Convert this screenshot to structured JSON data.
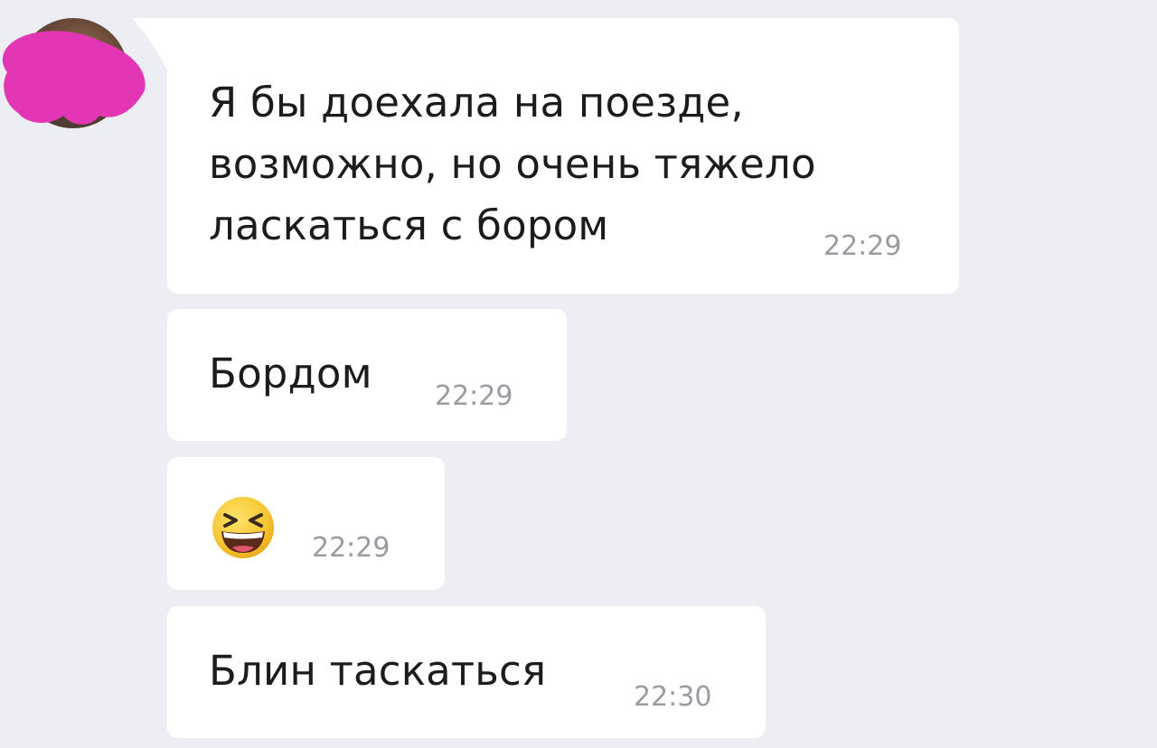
{
  "colors": {
    "background": "#edeef3",
    "bubble": "#ffffff",
    "text": "#1c1c1e",
    "time": "#9a9ba3",
    "scribble": "#e336b4"
  },
  "contact": {
    "avatar_icon": "avatar-icon"
  },
  "messages": [
    {
      "lines": [
        "Я бы доехала на поезде,",
        "возможно, но очень тяжело",
        "ласкаться с бором"
      ],
      "time": "22:29"
    },
    {
      "text": "Бордом",
      "time": "22:29"
    },
    {
      "emoji_icon": "laughing-squinting-face-icon",
      "time": "22:29"
    },
    {
      "text": "Блин таскаться",
      "time": "22:30"
    }
  ]
}
